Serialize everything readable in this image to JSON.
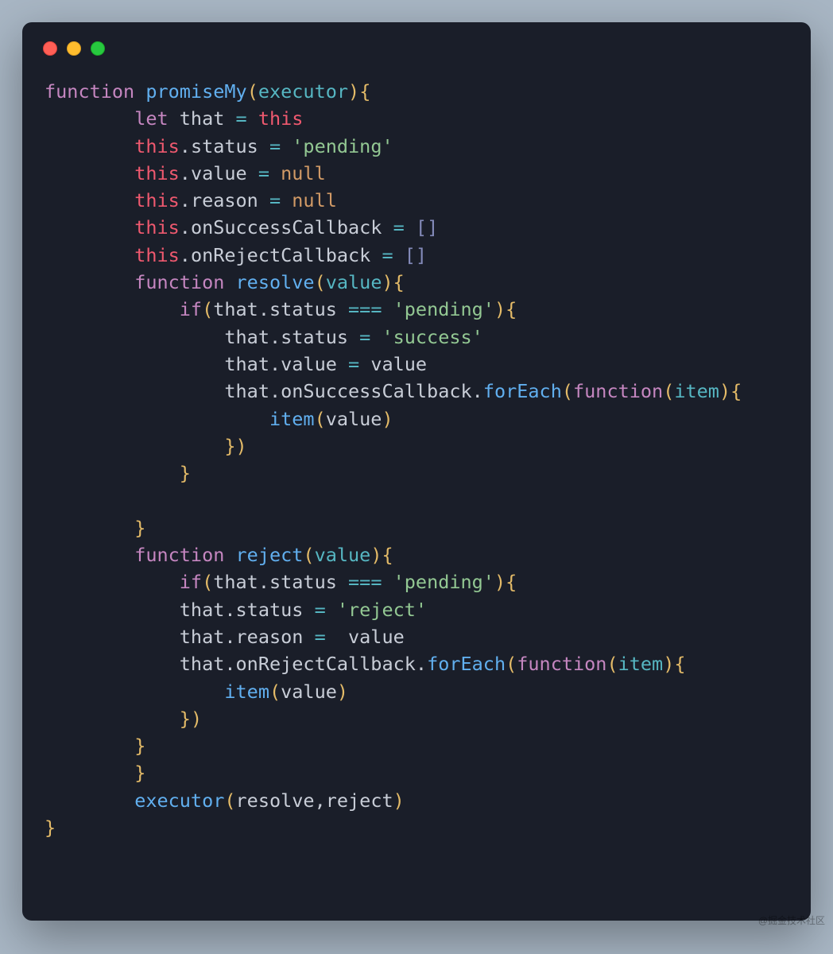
{
  "window": {
    "buttons": [
      "close",
      "minimize",
      "zoom"
    ]
  },
  "syntax_colors": {
    "keyword": "#c586c0",
    "funcdef": "#e5c07b",
    "fname": "#61afef",
    "param": "#56b6c2",
    "punct": "#e4bb68",
    "default": "#c8cdd7",
    "this": "#ef596f",
    "prop": "#c8cdd7",
    "op": "#56b6c2",
    "string": "#93c893",
    "null": "#d19a66",
    "brackets": "#848bba"
  },
  "code": {
    "tokens": [
      [
        [
          "function ",
          "keyword"
        ],
        [
          "promiseMy",
          "fname"
        ],
        [
          "(",
          "punct"
        ],
        [
          "executor",
          "param"
        ],
        [
          ")",
          "punct"
        ],
        [
          "{",
          "punct"
        ]
      ],
      [
        [
          "        ",
          ""
        ],
        [
          "let ",
          "keyword"
        ],
        [
          "that",
          "default"
        ],
        [
          " = ",
          "op"
        ],
        [
          "this",
          "this"
        ]
      ],
      [
        [
          "        ",
          ""
        ],
        [
          "this",
          "this"
        ],
        [
          ".",
          "default"
        ],
        [
          "status",
          "prop"
        ],
        [
          " = ",
          "op"
        ],
        [
          "'pending'",
          "string"
        ]
      ],
      [
        [
          "        ",
          ""
        ],
        [
          "this",
          "this"
        ],
        [
          ".",
          "default"
        ],
        [
          "value",
          "prop"
        ],
        [
          " = ",
          "op"
        ],
        [
          "null",
          "null"
        ]
      ],
      [
        [
          "        ",
          ""
        ],
        [
          "this",
          "this"
        ],
        [
          ".",
          "default"
        ],
        [
          "reason",
          "prop"
        ],
        [
          " = ",
          "op"
        ],
        [
          "null",
          "null"
        ]
      ],
      [
        [
          "        ",
          ""
        ],
        [
          "this",
          "this"
        ],
        [
          ".",
          "default"
        ],
        [
          "onSuccessCallback",
          "prop"
        ],
        [
          " = ",
          "op"
        ],
        [
          "[]",
          "brackets"
        ]
      ],
      [
        [
          "        ",
          ""
        ],
        [
          "this",
          "this"
        ],
        [
          ".",
          "default"
        ],
        [
          "onRejectCallback",
          "prop"
        ],
        [
          " = ",
          "op"
        ],
        [
          "[]",
          "brackets"
        ]
      ],
      [
        [
          "        ",
          ""
        ],
        [
          "function ",
          "keyword"
        ],
        [
          "resolve",
          "fname"
        ],
        [
          "(",
          "punct"
        ],
        [
          "value",
          "param"
        ],
        [
          ")",
          "punct"
        ],
        [
          "{",
          "punct"
        ]
      ],
      [
        [
          "            ",
          ""
        ],
        [
          "if",
          "keyword"
        ],
        [
          "(",
          "punct"
        ],
        [
          "that",
          "default"
        ],
        [
          ".",
          "default"
        ],
        [
          "status",
          "prop"
        ],
        [
          " === ",
          "op"
        ],
        [
          "'pending'",
          "string"
        ],
        [
          ")",
          "punct"
        ],
        [
          "{",
          "punct"
        ]
      ],
      [
        [
          "                ",
          ""
        ],
        [
          "that",
          "default"
        ],
        [
          ".",
          "default"
        ],
        [
          "status",
          "prop"
        ],
        [
          " = ",
          "op"
        ],
        [
          "'success'",
          "string"
        ]
      ],
      [
        [
          "                ",
          ""
        ],
        [
          "that",
          "default"
        ],
        [
          ".",
          "default"
        ],
        [
          "value",
          "prop"
        ],
        [
          " = ",
          "op"
        ],
        [
          "value",
          "default"
        ]
      ],
      [
        [
          "                ",
          ""
        ],
        [
          "that",
          "default"
        ],
        [
          ".",
          "default"
        ],
        [
          "onSuccessCallback",
          "prop"
        ],
        [
          ".",
          "default"
        ],
        [
          "forEach",
          "fname"
        ],
        [
          "(",
          "punct"
        ],
        [
          "function",
          "keyword"
        ],
        [
          "(",
          "punct"
        ],
        [
          "item",
          "param"
        ],
        [
          ")",
          "punct"
        ],
        [
          "{",
          "punct"
        ]
      ],
      [
        [
          "                    ",
          ""
        ],
        [
          "item",
          "fname"
        ],
        [
          "(",
          "punct"
        ],
        [
          "value",
          "default"
        ],
        [
          ")",
          "punct"
        ]
      ],
      [
        [
          "                ",
          ""
        ],
        [
          "}",
          "punct"
        ],
        [
          ")",
          "punct"
        ]
      ],
      [
        [
          "            ",
          ""
        ],
        [
          "}",
          "punct"
        ]
      ],
      [
        [
          "",
          ""
        ]
      ],
      [
        [
          "        ",
          ""
        ],
        [
          "}",
          "punct"
        ]
      ],
      [
        [
          "        ",
          ""
        ],
        [
          "function ",
          "keyword"
        ],
        [
          "reject",
          "fname"
        ],
        [
          "(",
          "punct"
        ],
        [
          "value",
          "param"
        ],
        [
          ")",
          "punct"
        ],
        [
          "{",
          "punct"
        ]
      ],
      [
        [
          "            ",
          ""
        ],
        [
          "if",
          "keyword"
        ],
        [
          "(",
          "punct"
        ],
        [
          "that",
          "default"
        ],
        [
          ".",
          "default"
        ],
        [
          "status",
          "prop"
        ],
        [
          " === ",
          "op"
        ],
        [
          "'pending'",
          "string"
        ],
        [
          ")",
          "punct"
        ],
        [
          "{",
          "punct"
        ]
      ],
      [
        [
          "            ",
          ""
        ],
        [
          "that",
          "default"
        ],
        [
          ".",
          "default"
        ],
        [
          "status",
          "prop"
        ],
        [
          " = ",
          "op"
        ],
        [
          "'reject'",
          "string"
        ]
      ],
      [
        [
          "            ",
          ""
        ],
        [
          "that",
          "default"
        ],
        [
          ".",
          "default"
        ],
        [
          "reason",
          "prop"
        ],
        [
          " =  ",
          "op"
        ],
        [
          "value",
          "default"
        ]
      ],
      [
        [
          "            ",
          ""
        ],
        [
          "that",
          "default"
        ],
        [
          ".",
          "default"
        ],
        [
          "onRejectCallback",
          "prop"
        ],
        [
          ".",
          "default"
        ],
        [
          "forEach",
          "fname"
        ],
        [
          "(",
          "punct"
        ],
        [
          "function",
          "keyword"
        ],
        [
          "(",
          "punct"
        ],
        [
          "item",
          "param"
        ],
        [
          ")",
          "punct"
        ],
        [
          "{",
          "punct"
        ]
      ],
      [
        [
          "                ",
          ""
        ],
        [
          "item",
          "fname"
        ],
        [
          "(",
          "punct"
        ],
        [
          "value",
          "default"
        ],
        [
          ")",
          "punct"
        ]
      ],
      [
        [
          "            ",
          ""
        ],
        [
          "}",
          "punct"
        ],
        [
          ")",
          "punct"
        ]
      ],
      [
        [
          "        ",
          ""
        ],
        [
          "}",
          "punct"
        ]
      ],
      [
        [
          "        ",
          ""
        ],
        [
          "}",
          "punct"
        ]
      ],
      [
        [
          "        ",
          ""
        ],
        [
          "executor",
          "fname"
        ],
        [
          "(",
          "punct"
        ],
        [
          "resolve",
          "default"
        ],
        [
          ",",
          "default"
        ],
        [
          "reject",
          "default"
        ],
        [
          ")",
          "punct"
        ]
      ],
      [
        [
          "}",
          "punct"
        ]
      ]
    ]
  },
  "watermark": "@掘金技术社区"
}
